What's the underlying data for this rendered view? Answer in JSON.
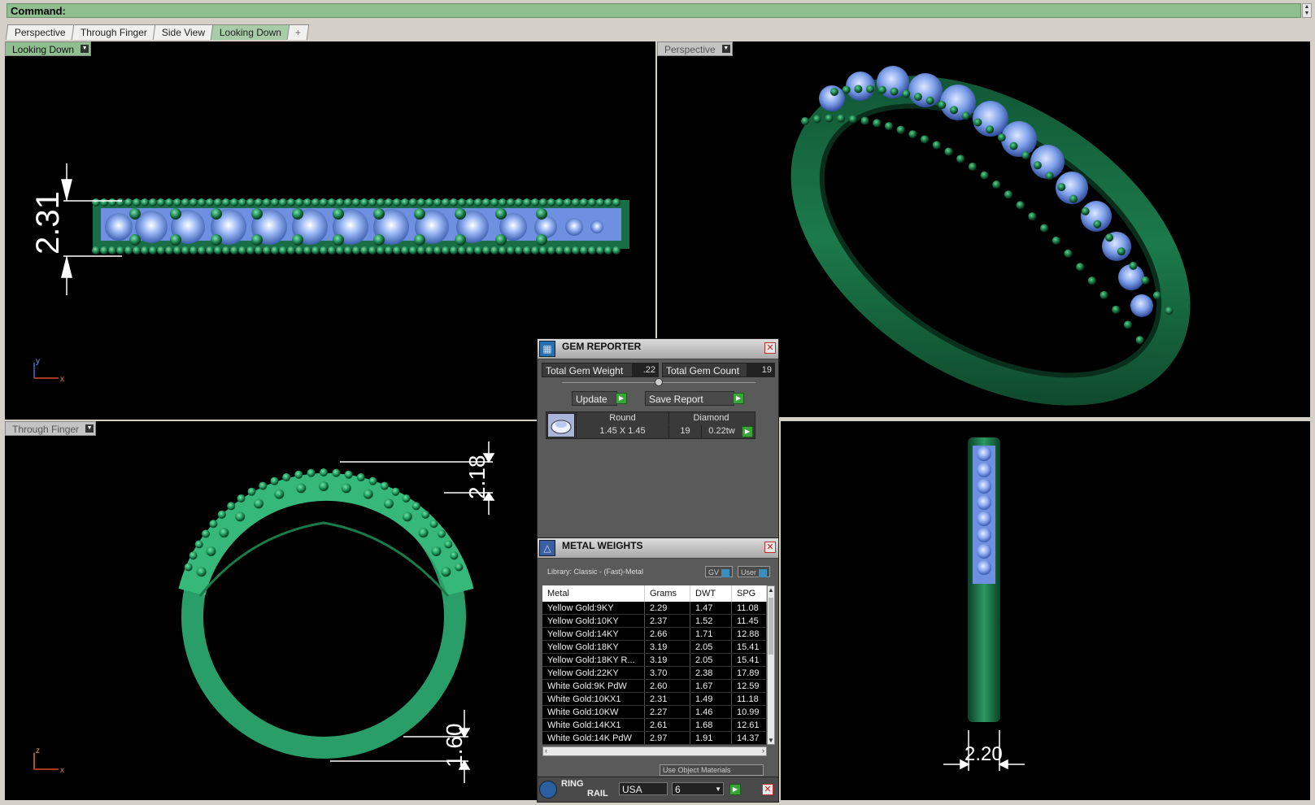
{
  "command": {
    "label": "Command:"
  },
  "tabs": [
    {
      "label": "Perspective"
    },
    {
      "label": "Through Finger"
    },
    {
      "label": "Side View"
    },
    {
      "label": "Looking Down"
    },
    {
      "label": "+"
    }
  ],
  "viewports": {
    "top_left": {
      "label": "Looking Down",
      "dimension": "2.31",
      "axis_a": "y",
      "axis_b": "x"
    },
    "top_right": {
      "label": "Perspective"
    },
    "bottom_left": {
      "label": "Through Finger",
      "dim_top": "2.18",
      "dim_bottom": "1.60",
      "axis_a": "z",
      "axis_b": "x"
    },
    "bottom_right": {
      "dimension": "2.20"
    }
  },
  "gem_reporter": {
    "title": "GEM REPORTER",
    "total_weight_label": "Total Gem Weight",
    "total_weight_value": ".22",
    "total_count_label": "Total Gem Count",
    "total_count_value": "19",
    "update_label": "Update",
    "save_label": "Save Report",
    "gem": {
      "shape": "Round",
      "material": "Diamond",
      "size": "1.45 X 1.45",
      "count": "19",
      "weight": "0.22tw"
    }
  },
  "metal_weights": {
    "title": "METAL WEIGHTS",
    "library": "Library: Classic - (Fast)-Metal",
    "gv_label": "GV",
    "user_label": "User",
    "columns": [
      "Metal",
      "Grams",
      "DWT",
      "SPG"
    ],
    "rows": [
      [
        "Yellow Gold:9KY",
        "2.29",
        "1.47",
        "11.08"
      ],
      [
        "Yellow Gold:10KY",
        "2.37",
        "1.52",
        "11.45"
      ],
      [
        "Yellow Gold:14KY",
        "2.66",
        "1.71",
        "12.88"
      ],
      [
        "Yellow Gold:18KY",
        "3.19",
        "2.05",
        "15.41"
      ],
      [
        "Yellow Gold:18KY R...",
        "3.19",
        "2.05",
        "15.41"
      ],
      [
        "Yellow Gold:22KY",
        "3.70",
        "2.38",
        "17.89"
      ],
      [
        "White Gold:9K PdW",
        "2.60",
        "1.67",
        "12.59"
      ],
      [
        "White Gold:10KX1",
        "2.31",
        "1.49",
        "11.18"
      ],
      [
        "White Gold:10KW",
        "2.27",
        "1.46",
        "10.99"
      ],
      [
        "White Gold:14KX1",
        "2.61",
        "1.68",
        "12.61"
      ],
      [
        "White Gold:14K PdW",
        "2.97",
        "1.91",
        "14.37"
      ]
    ],
    "use_object_materials": "Use Object Materials"
  },
  "ring_rail": {
    "title_line1": "RING",
    "title_line2": "RAIL",
    "region": "USA",
    "size": "6"
  }
}
